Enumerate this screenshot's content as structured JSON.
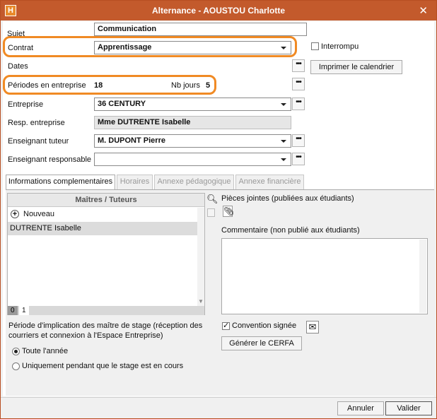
{
  "window": {
    "title": "Alternance - AOUSTOU Charlotte",
    "app_icon": "H"
  },
  "form": {
    "sujet": {
      "label": "Sujet",
      "value": "Communication"
    },
    "contrat": {
      "label": "Contrat",
      "value": "Apprentissage"
    },
    "interrompu": {
      "label": "Interrompu",
      "checked": false
    },
    "dates": {
      "label": "Dates"
    },
    "imprimer_calendrier": "Imprimer le calendrier",
    "periodes": {
      "label": "Périodes en entreprise",
      "value": "18",
      "nbjours_label": "Nb jours",
      "nbjours_value": "5"
    },
    "entreprise": {
      "label": "Entreprise",
      "value": "36 CENTURY"
    },
    "resp_entreprise": {
      "label": "Resp. entreprise",
      "value": "Mme DUTRENTE Isabelle"
    },
    "enseignant_tuteur": {
      "label": "Enseignant tuteur",
      "value": "M. DUPONT Pierre"
    },
    "enseignant_responsable": {
      "label": "Enseignant responsable",
      "value": ""
    },
    "dots": "•••"
  },
  "tabs": [
    {
      "label": "Informations complementaires",
      "active": true
    },
    {
      "label": "Horaires",
      "active": false
    },
    {
      "label": "Annexe pédagogique",
      "active": false
    },
    {
      "label": "Annexe financière",
      "active": false
    }
  ],
  "maitres": {
    "header": "Maîtres / Tuteurs",
    "new_label": "Nouveau",
    "rows": [
      "DUTRENTE Isabelle"
    ],
    "footer": [
      "0",
      "1"
    ]
  },
  "implication": {
    "text": "Période d'implication des maître de stage (réception des courriers et connexion à l'Espace Entreprise)",
    "options": [
      {
        "label": "Toute l'année",
        "selected": true
      },
      {
        "label": "Uniquement pendant que le stage est en cours",
        "selected": false
      }
    ]
  },
  "pieces_jointes": {
    "label": "Pièces jointes (publiées aux étudiants)"
  },
  "commentaire": {
    "label": "Commentaire (non publié aux étudiants)",
    "value": ""
  },
  "convention": {
    "label": "Convention signée",
    "checked": true
  },
  "generer_cerfa": "Générer le CERFA",
  "buttons": {
    "annuler": "Annuler",
    "valider": "Valider"
  },
  "colors": {
    "title_bar": "#c35a2c",
    "highlight": "#f08a24"
  },
  "icons": [
    "close-icon",
    "search-icon",
    "trash-icon",
    "paperclip-icon",
    "mail-icon",
    "plus-icon"
  ]
}
